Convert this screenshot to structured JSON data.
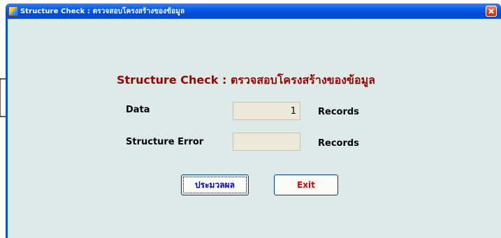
{
  "window": {
    "title": "Structure Check :  ตรวจสอบโครงสร้างของข้อมูล",
    "icon": "app-icon",
    "close_icon": "close-icon"
  },
  "form": {
    "heading": "Structure Check : ตรวจสอบโครงสร้างของข้อมูล",
    "data_label": "Data",
    "data_value": "1",
    "data_unit": "Records",
    "error_label": "Structure Error",
    "error_value": "",
    "error_unit": "Records"
  },
  "buttons": {
    "process_label": "ประมวลผล",
    "exit_label": "Exit"
  },
  "colors": {
    "titlebar": "#0a5fe6",
    "client_background": "#ddeae8",
    "heading": "#990000",
    "process_text": "#0000cc",
    "exit_text": "#d40000"
  }
}
